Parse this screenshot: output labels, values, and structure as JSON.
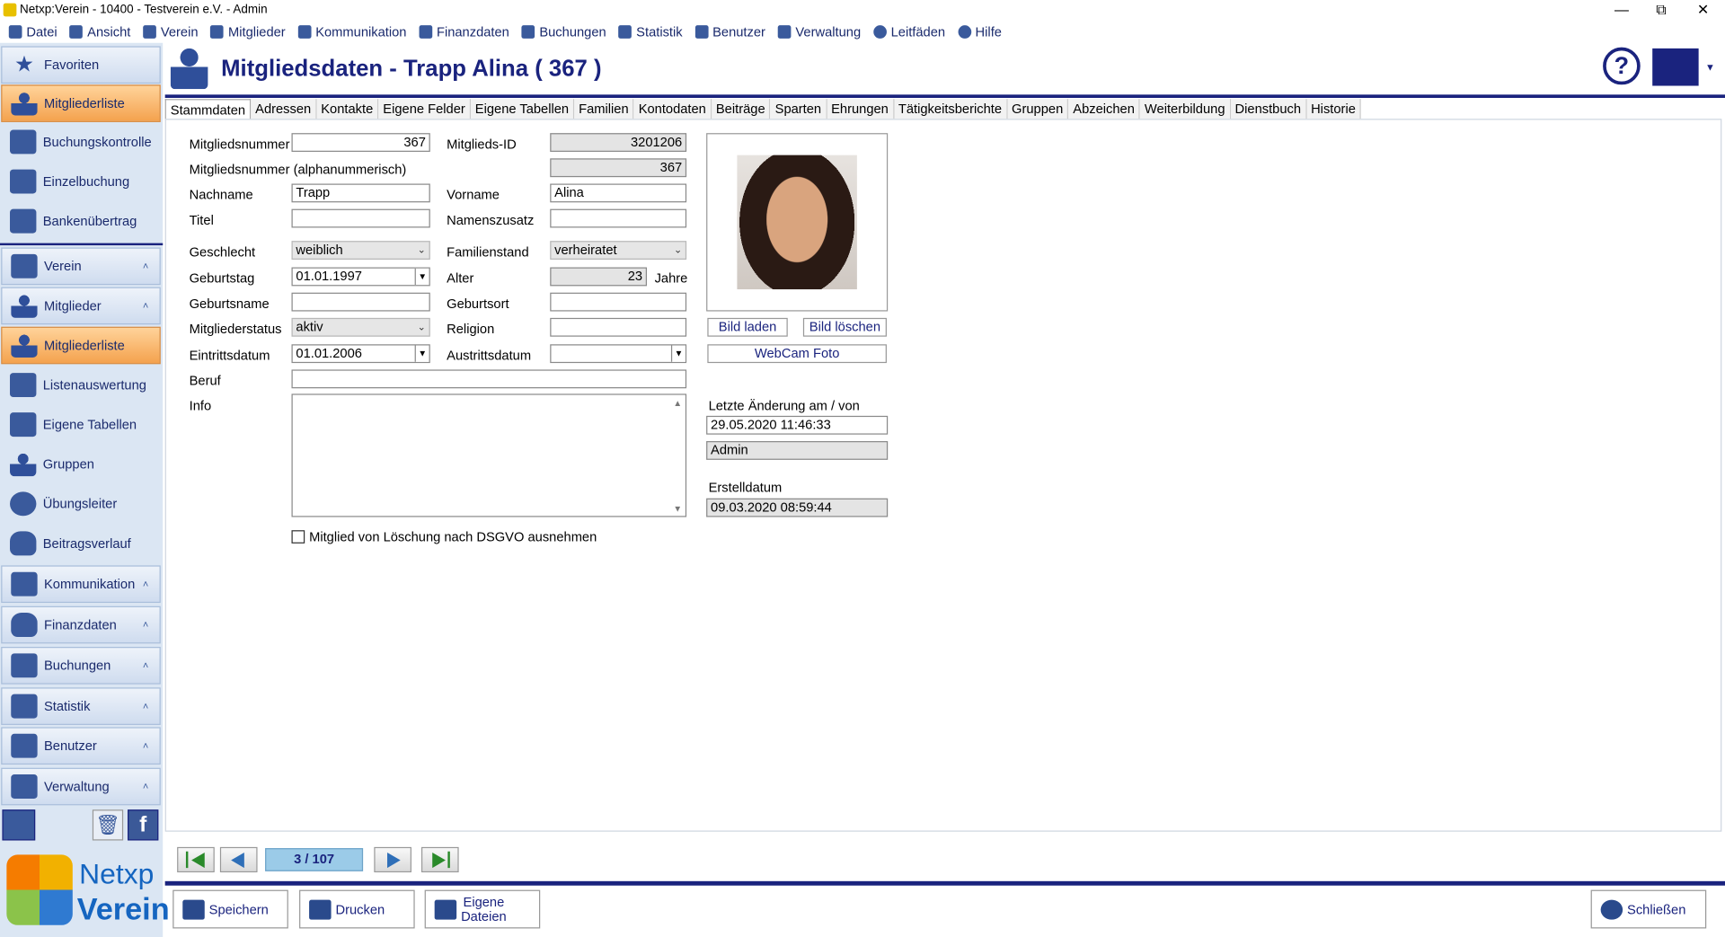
{
  "window": {
    "title": "Netxp:Verein - 10400 - Testverein e.V. - Admin"
  },
  "menu": [
    "Datei",
    "Ansicht",
    "Verein",
    "Mitglieder",
    "Kommunikation",
    "Finanzdaten",
    "Buchungen",
    "Statistik",
    "Benutzer",
    "Verwaltung",
    "Leitfäden",
    "Hilfe"
  ],
  "sidebar": {
    "favoriten": "Favoriten",
    "fav_items": [
      "Mitgliederliste",
      "Buchungskontrolle",
      "Einzelbuchung",
      "Bankenübertrag"
    ],
    "verein": "Verein",
    "mitglieder": "Mitglieder",
    "mitglieder_items": [
      "Mitgliederliste",
      "Listenauswertung",
      "Eigene Tabellen",
      "Gruppen",
      "Übungsleiter",
      "Beitragsverlauf"
    ],
    "sections": [
      "Kommunikation",
      "Finanzdaten",
      "Buchungen",
      "Statistik",
      "Benutzer",
      "Verwaltung"
    ]
  },
  "header": {
    "title": "Mitgliedsdaten - Trapp Alina ( 367 )"
  },
  "tabs": [
    "Stammdaten",
    "Adressen",
    "Kontakte",
    "Eigene Felder",
    "Eigene Tabellen",
    "Familien",
    "Kontodaten",
    "Beiträge",
    "Sparten",
    "Ehrungen",
    "Tätigkeitsberichte",
    "Gruppen",
    "Abzeichen",
    "Weiterbildung",
    "Dienstbuch",
    "Historie"
  ],
  "form": {
    "mitgliedsnummer_label": "Mitgliedsnummer",
    "mitgliedsnummer": "367",
    "mitglieds_id_label": "Mitglieds-ID",
    "mitglieds_id": "3201206",
    "alpha_label": "Mitgliedsnummer (alphanummerisch)",
    "alpha": "367",
    "nachname_label": "Nachname",
    "nachname": "Trapp",
    "vorname_label": "Vorname",
    "vorname": "Alina",
    "titel_label": "Titel",
    "titel": "",
    "namenszusatz_label": "Namenszusatz",
    "namenszusatz": "",
    "geschlecht_label": "Geschlecht",
    "geschlecht": "weiblich",
    "familienstand_label": "Familienstand",
    "familienstand": "verheiratet",
    "geburtstag_label": "Geburtstag",
    "geburtstag": "01.01.1997",
    "alter_label": "Alter",
    "alter": "23",
    "jahre_label": "Jahre",
    "geburtsname_label": "Geburtsname",
    "geburtsname": "",
    "geburtsort_label": "Geburtsort",
    "geburtsort": "",
    "status_label": "Mitgliederstatus",
    "status": "aktiv",
    "religion_label": "Religion",
    "religion": "",
    "eintritt_label": "Eintrittsdatum",
    "eintritt": "01.01.2006",
    "austritt_label": "Austrittsdatum",
    "austritt": "",
    "beruf_label": "Beruf",
    "beruf": "",
    "info_label": "Info",
    "info": "",
    "dsgvo_label": "Mitglied von Löschung nach DSGVO ausnehmen"
  },
  "photo_panel": {
    "bild_laden": "Bild laden",
    "bild_loeschen": "Bild löschen",
    "webcam": "WebCam Foto",
    "letzte_aenderung_label": "Letzte Änderung am / von",
    "letzte_aenderung": "29.05.2020 11:46:33",
    "geaendert_von": "Admin",
    "erstelldatum_label": "Erstelldatum",
    "erstelldatum": "09.03.2020 08:59:44"
  },
  "pager": "3 / 107",
  "bottom": {
    "speichern": "Speichern",
    "drucken": "Drucken",
    "eigene_dateien_1": "Eigene",
    "eigene_dateien_2": "Dateien",
    "schliessen": "Schließen"
  },
  "logo": {
    "line1": "Netxp",
    "line2": "Verein"
  },
  "colors": {
    "accent": "#1a237e",
    "sidebar_active": "#f4a24e"
  }
}
